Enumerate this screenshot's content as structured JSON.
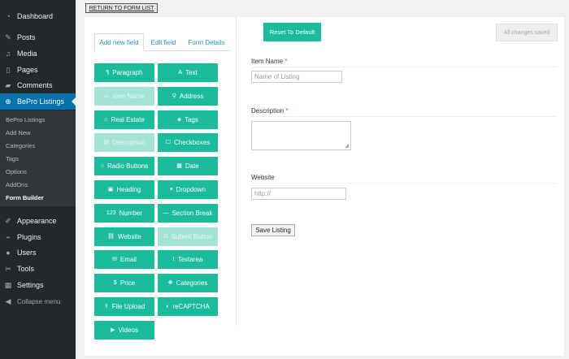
{
  "sidebar": {
    "menu": [
      {
        "label": "Dashboard",
        "icon": "dashboard-icon"
      },
      {
        "label": "Posts",
        "icon": "pin-icon"
      },
      {
        "label": "Media",
        "icon": "media-icon"
      },
      {
        "label": "Pages",
        "icon": "pages-icon"
      },
      {
        "label": "Comments",
        "icon": "comment-icon"
      },
      {
        "label": "BePro Listings",
        "icon": "globe-icon"
      }
    ],
    "submenu": [
      "BePro Listings",
      "Add New",
      "Categories",
      "Tags",
      "Options",
      "AddOns",
      "Form Builder"
    ],
    "menu2": [
      {
        "label": "Appearance",
        "icon": "brush-icon"
      },
      {
        "label": "Plugins",
        "icon": "plug-icon"
      },
      {
        "label": "Users",
        "icon": "user-icon"
      },
      {
        "label": "Tools",
        "icon": "wrench-icon"
      },
      {
        "label": "Settings",
        "icon": "settings-icon"
      }
    ],
    "collapse": "Collapse menu"
  },
  "return_label": "RETURN TO FORM LIST",
  "tabs": [
    "Add new field",
    "Edit field",
    "Form Details"
  ],
  "fields": [
    {
      "label": "Paragraph",
      "icon": "¶",
      "disabled": false
    },
    {
      "label": "Text",
      "icon": "A",
      "disabled": false
    },
    {
      "label": "Item Name",
      "icon": "▭",
      "disabled": true
    },
    {
      "label": "Address",
      "icon": "⚲",
      "disabled": false
    },
    {
      "label": "Real Estate",
      "icon": "⌂",
      "disabled": false
    },
    {
      "label": "Tags",
      "icon": "⬥",
      "disabled": false
    },
    {
      "label": "Description",
      "icon": "▤",
      "disabled": true
    },
    {
      "label": "Checkboxes",
      "icon": "☐",
      "disabled": false
    },
    {
      "label": "Radio Buttons",
      "icon": "○",
      "disabled": false
    },
    {
      "label": "Date",
      "icon": "▦",
      "disabled": false
    },
    {
      "label": "Heading",
      "icon": "▣",
      "disabled": false
    },
    {
      "label": "Dropdown",
      "icon": "▾",
      "disabled": false
    },
    {
      "label": "Number",
      "icon": "123",
      "disabled": false
    },
    {
      "label": "Section Break",
      "icon": "—",
      "disabled": false
    },
    {
      "label": "Website",
      "icon": "⛓",
      "disabled": false
    },
    {
      "label": "Submit Button",
      "icon": "⊡",
      "disabled": true
    },
    {
      "label": "Email",
      "icon": "✉",
      "disabled": false
    },
    {
      "label": "Textarea",
      "icon": "Ⅰ",
      "disabled": false
    },
    {
      "label": "Price",
      "icon": "$",
      "disabled": false
    },
    {
      "label": "Categories",
      "icon": "✥",
      "disabled": false
    },
    {
      "label": "File Upload",
      "icon": "⇪",
      "disabled": false
    },
    {
      "label": "reCAPTCHA",
      "icon": "◐",
      "disabled": false
    },
    {
      "label": "Videos",
      "icon": "▶",
      "disabled": false
    }
  ],
  "reset_label": "Reset To Default",
  "saved_label": "All changes saved",
  "form": {
    "item_name_label": "Item Name",
    "required_mark": "*",
    "item_name_placeholder": "Name of Listing",
    "description_label": "Description",
    "website_label": "Website",
    "website_placeholder": "http://",
    "save_label": "Save Listing"
  },
  "colors": {
    "accent": "#1abc9c",
    "active_menu": "#0073aa",
    "sidebar": "#23282d"
  }
}
